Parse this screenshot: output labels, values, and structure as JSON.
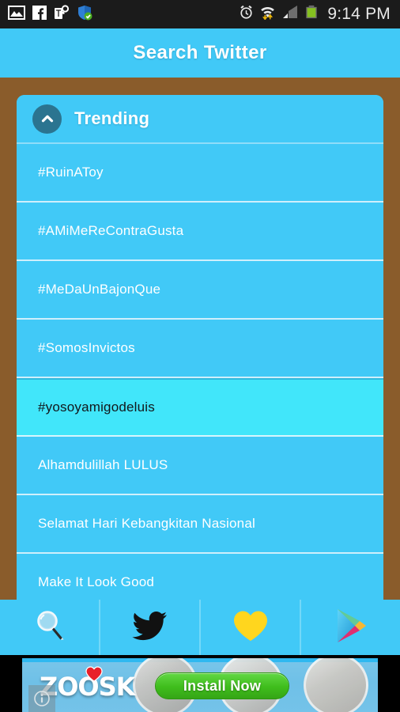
{
  "status_bar": {
    "time": "9:14 PM",
    "left_icons": [
      "photo-icon",
      "facebook-icon",
      "tmobile-key-icon",
      "shield-check-icon"
    ],
    "right_icons": [
      "alarm-clock-icon",
      "wifi-transfer-icon",
      "cellular-signal-icon",
      "battery-icon"
    ]
  },
  "action_bar": {
    "title": "Search Twitter"
  },
  "card": {
    "header": {
      "label": "Trending",
      "toggle_icon": "chevron-up-icon"
    },
    "items": [
      {
        "label": "#RuinAToy",
        "selected": false
      },
      {
        "label": "#AMiMeReContraGusta",
        "selected": false
      },
      {
        "label": "#MeDaUnBajonQue",
        "selected": false
      },
      {
        "label": "#SomosInvictos",
        "selected": false
      },
      {
        "label": "#yosoyamigodeluis",
        "selected": true
      },
      {
        "label": "Alhamdulillah LULUS",
        "selected": false
      },
      {
        "label": "Selamat Hari Kebangkitan Nasional",
        "selected": false
      },
      {
        "label": "Make It Look Good",
        "selected": false
      }
    ]
  },
  "bottom_nav": [
    {
      "name": "search-tab",
      "icon": "magnifier-icon"
    },
    {
      "name": "twitter-tab",
      "icon": "twitter-bird-icon"
    },
    {
      "name": "favorites-tab",
      "icon": "heart-icon"
    },
    {
      "name": "play-store-tab",
      "icon": "google-play-icon"
    }
  ],
  "ad": {
    "brand": "ZOOSK",
    "cta_label": "Install Now",
    "info_label": "i"
  },
  "colors": {
    "accent_blue": "#41c9f7",
    "selected_blue": "#41e6fa",
    "page_brown": "#8a5c2b",
    "chevron_circle": "#2b7490",
    "cta_green": "#3fbd1c",
    "heart_yellow": "#ffd61e"
  }
}
